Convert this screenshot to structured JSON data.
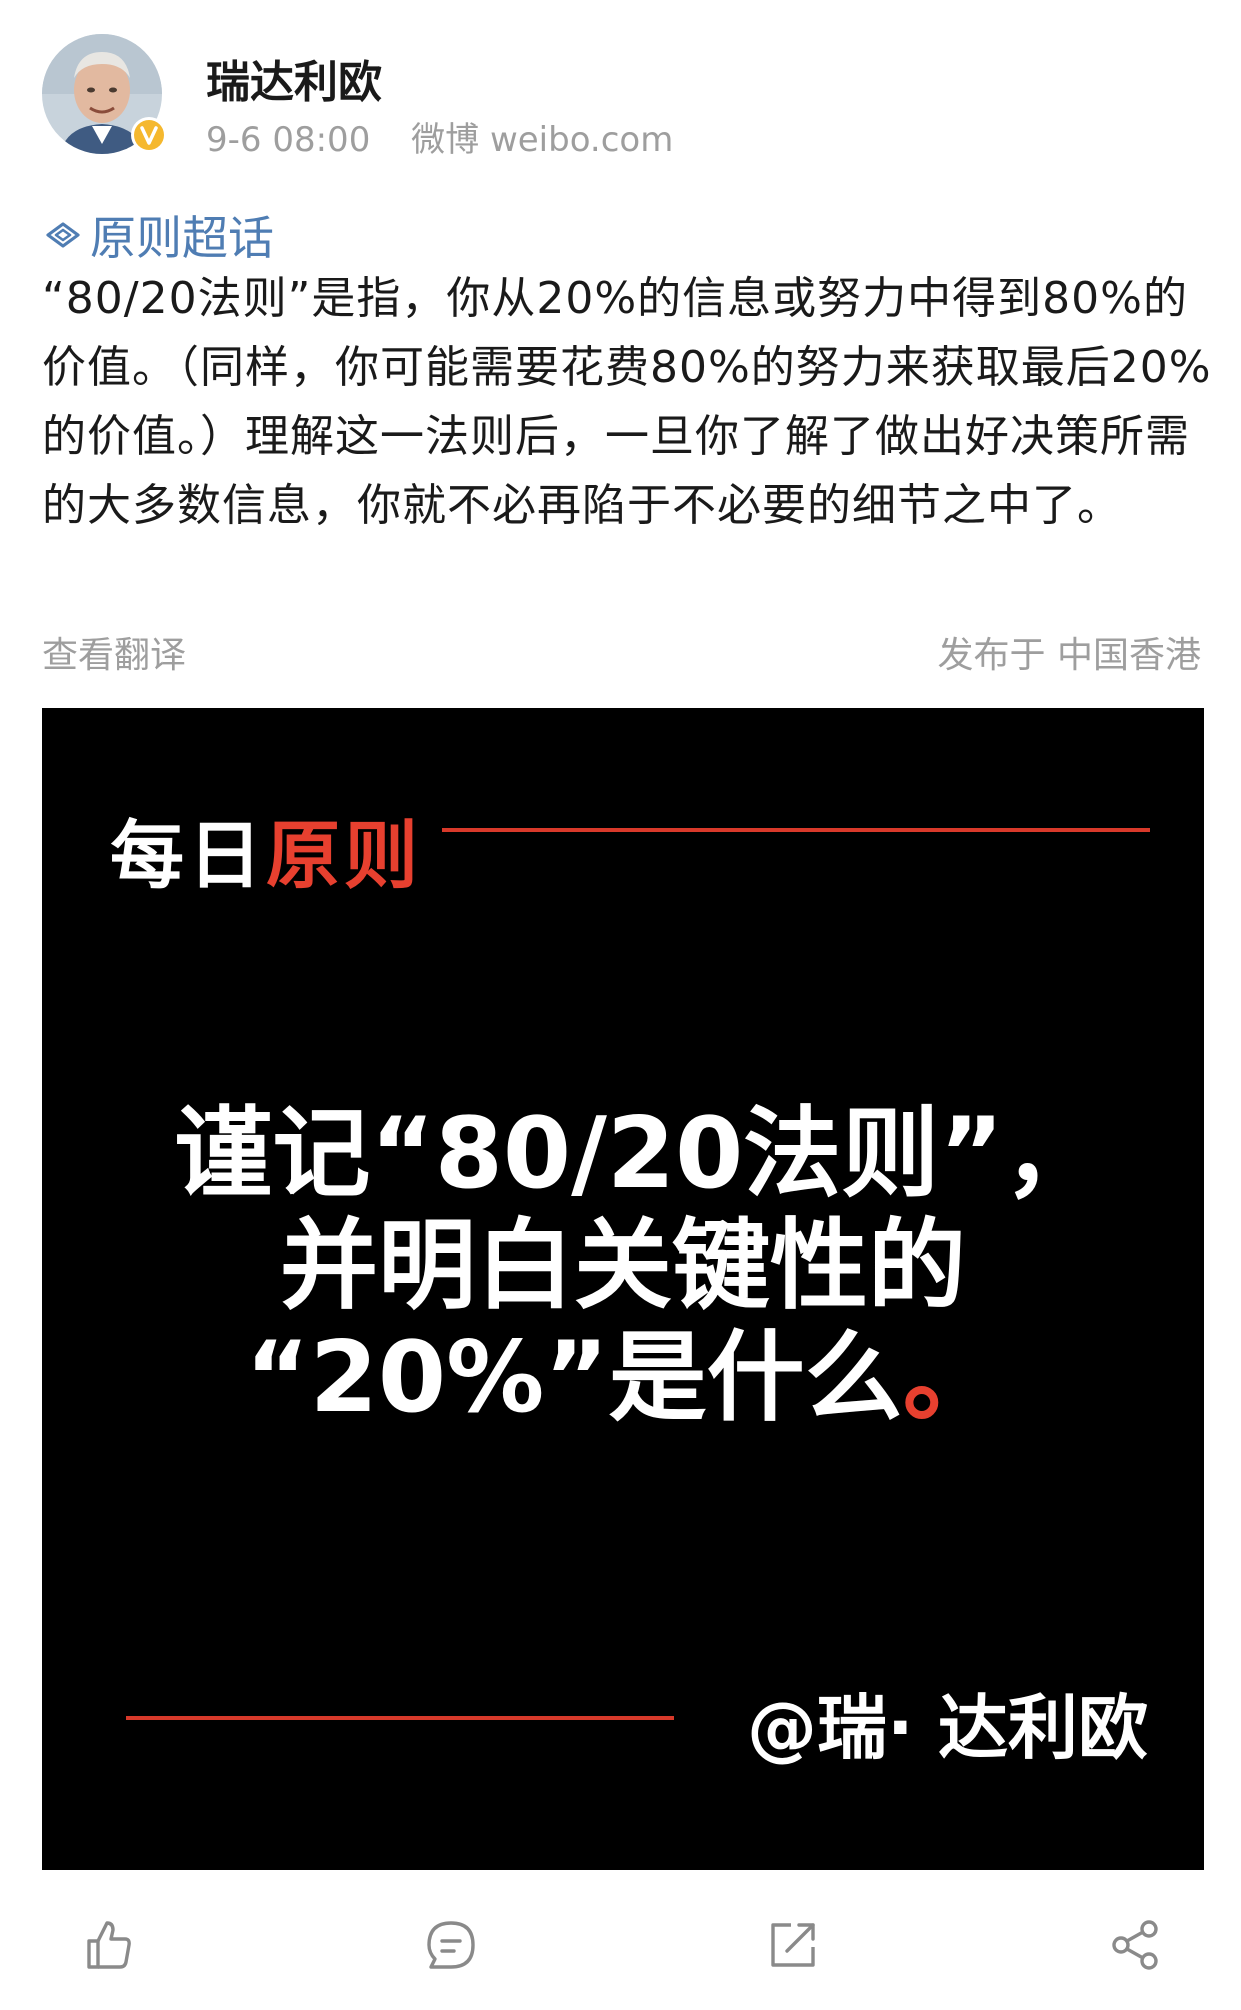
{
  "author": {
    "name": "瑞达利欧",
    "avatar_icon": "portrait-avatar",
    "verified_icon": "verified-v-icon",
    "verified_color": "#f5b82e"
  },
  "meta": {
    "time": "9-6 08:00",
    "source": "微博 weibo.com"
  },
  "post": {
    "topic_icon": "diamond-topic-icon",
    "topic": "原则超话",
    "text": "“80/20法则”是指，你从20%的信息或努力中得到80%的价值。（同样，你可能需要花费80%的努力来获取最后20%的价值。）理解这一法则后，一旦你了解了做出好决策所需的大多数信息，你就不必再陷于不必要的细节之中了。",
    "translate_label": "查看翻译",
    "location": "发布于 中国香港",
    "link_color": "#4f7db3"
  },
  "image_card": {
    "heading_white": "每日",
    "heading_red": "原则",
    "quote_line_1": "谨记“80/20法则”，",
    "quote_line_2": "并明白关键性的",
    "quote_line_3": "“20%”是什么",
    "quote_end_mark": "。",
    "signature": "@瑞· 达利欧",
    "accent_color": "#e7402f",
    "background_color": "#000000"
  },
  "actions": {
    "like_icon": "thumbs-up-icon",
    "comment_icon": "comment-bubble-icon",
    "repost_icon": "repost-arrow-icon",
    "share_icon": "share-nodes-icon"
  }
}
